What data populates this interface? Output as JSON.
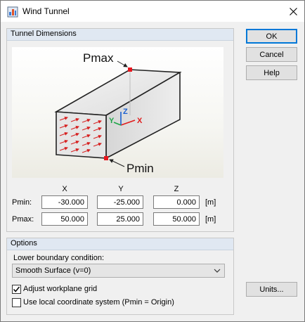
{
  "window": {
    "title": "Wind Tunnel"
  },
  "tunnel_dimensions": {
    "title": "Tunnel Dimensions",
    "illustration": {
      "pmax_label": "Pmax",
      "pmin_label": "Pmin",
      "axis_x": "X",
      "axis_y": "Y",
      "axis_z": "Z"
    },
    "columns": [
      "X",
      "Y",
      "Z"
    ],
    "rows": [
      {
        "label": "Pmin:",
        "x": "-30.000",
        "y": "-25.000",
        "z": "0.000",
        "unit": "[m]"
      },
      {
        "label": "Pmax:",
        "x": "50.000",
        "y": "25.000",
        "z": "50.000",
        "unit": "[m]"
      }
    ]
  },
  "options": {
    "title": "Options",
    "lower_boundary_label": "Lower boundary condition:",
    "lower_boundary_value": "Smooth Surface (v=0)",
    "adjust_workplane_label": "Adjust workplane grid",
    "adjust_workplane_checked": true,
    "local_coord_label": "Use local coordinate system (Pmin = Origin)",
    "local_coord_checked": false
  },
  "buttons": {
    "ok": "OK",
    "cancel": "Cancel",
    "help": "Help",
    "units": "Units..."
  },
  "colors": {
    "accent": "#0078d7",
    "group_header": "#e0e8f2",
    "marker": "#e8161e"
  }
}
